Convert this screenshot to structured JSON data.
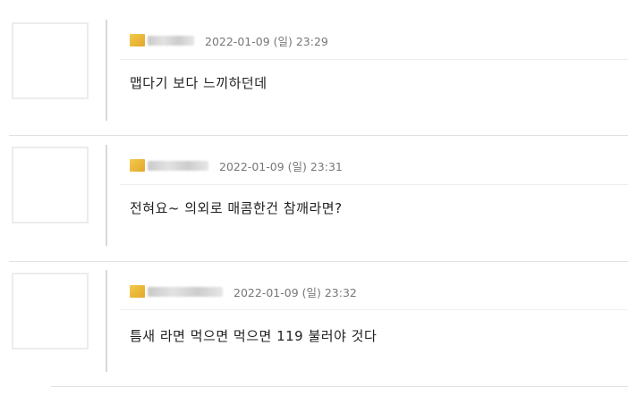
{
  "comments": [
    {
      "date": "2022-01-09 (일) 23:29",
      "text": "맵다기 보다 느끼하던데"
    },
    {
      "date": "2022-01-09 (일) 23:31",
      "text": "전혀요~ 의외로 매콤한건 참깨라면?"
    },
    {
      "date": "2022-01-09 (일) 23:32",
      "text": "틈새 라면 먹으면 먹으면 119 불러야 것다"
    }
  ]
}
